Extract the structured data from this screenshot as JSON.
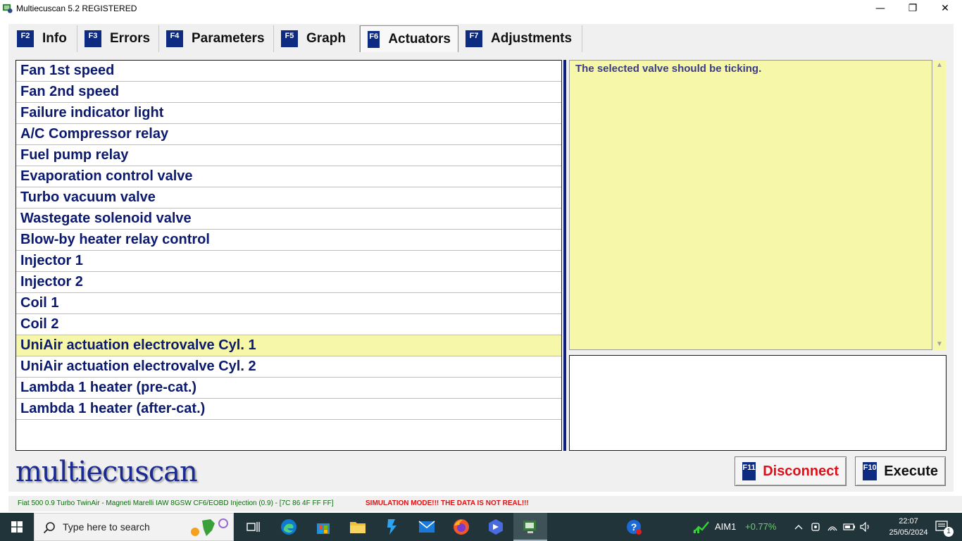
{
  "window": {
    "title": "Multiecuscan 5.2 REGISTERED",
    "minimize": "—",
    "maximize": "❐",
    "close": "✕"
  },
  "tabs": [
    {
      "key": "F2",
      "label": "Info"
    },
    {
      "key": "F3",
      "label": "Errors"
    },
    {
      "key": "F4",
      "label": "Parameters"
    },
    {
      "key": "F5",
      "label": "Graph"
    },
    {
      "key": "F6",
      "label": "Actuators"
    },
    {
      "key": "F7",
      "label": "Adjustments"
    }
  ],
  "active_tab": "Actuators",
  "actuators": [
    "Fan 1st speed",
    "Fan 2nd speed",
    "Failure indicator light",
    "A/C Compressor relay",
    "Fuel pump relay",
    "Evaporation control valve",
    "Turbo vacuum valve",
    "Wastegate solenoid valve",
    "Blow-by heater relay control",
    "Injector 1",
    "Injector 2",
    "Coil 1",
    "Coil 2",
    "UniAir actuation electrovalve Cyl. 1",
    "UniAir actuation electrovalve Cyl. 2",
    "Lambda 1 heater (pre-cat.)",
    "Lambda 1 heater (after-cat.)"
  ],
  "selected_actuator": "UniAir actuation electrovalve Cyl. 1",
  "info_text": "The selected valve should be ticking.",
  "logo_text": "multiecuscan",
  "buttons": {
    "disconnect": {
      "key": "F11",
      "label": "Disconnect"
    },
    "execute": {
      "key": "F10",
      "label": "Execute"
    }
  },
  "status": {
    "vehicle": "Fiat 500 0.9 Turbo TwinAir - Magneti Marelli IAW 8GSW CF6/EOBD Injection (0.9) - [7C 86 4F FF FF]",
    "simulation": "SIMULATION MODE!!! THE DATA IS NOT REAL!!!"
  },
  "taskbar": {
    "search_placeholder": "Type here to search",
    "stock_name": "AIM1",
    "stock_change": "+0.77%",
    "time": "22:07",
    "date": "25/05/2024",
    "notification_count": "1"
  },
  "colors": {
    "accent_blue": "#0d2b80",
    "list_text": "#0b1a6e",
    "selection": "#f7f7a9",
    "disconnect_red": "#e0101a",
    "status_green": "#0a6a0a"
  }
}
